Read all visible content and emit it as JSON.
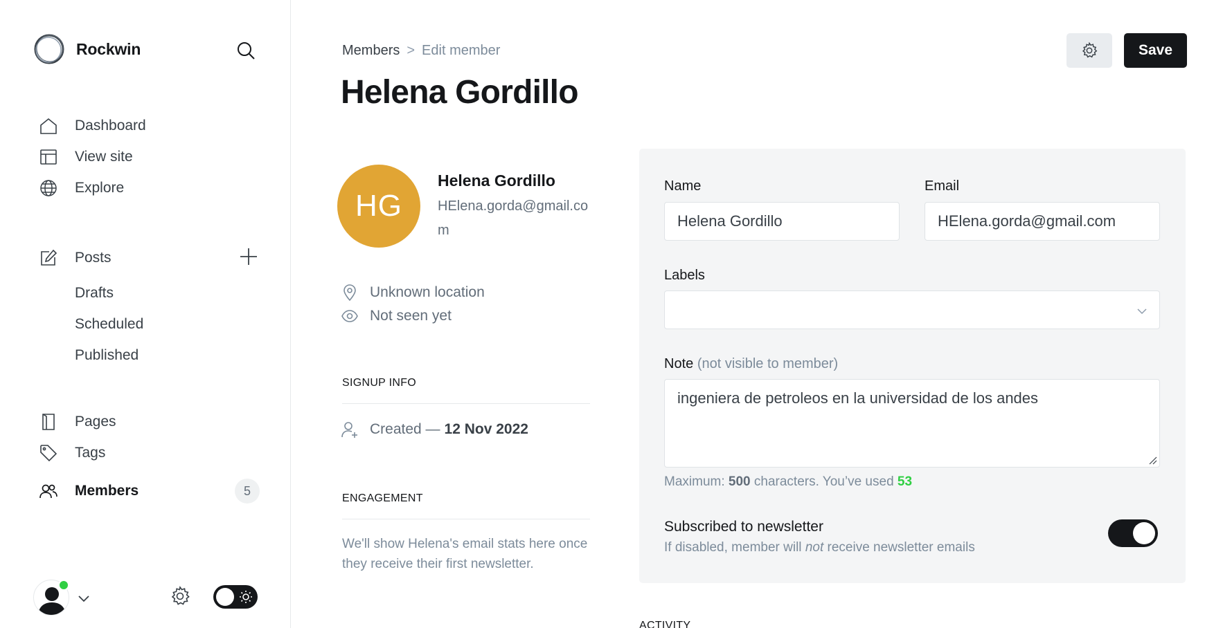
{
  "sidebar": {
    "brand": "Rockwin",
    "nav": {
      "dashboard": "Dashboard",
      "view_site": "View site",
      "explore": "Explore",
      "posts": "Posts",
      "drafts": "Drafts",
      "scheduled": "Scheduled",
      "published": "Published",
      "pages": "Pages",
      "tags": "Tags",
      "members": "Members",
      "members_count": "5"
    }
  },
  "header": {
    "breadcrumb_parent": "Members",
    "breadcrumb_separator": ">",
    "breadcrumb_current": "Edit member",
    "title": "Helena Gordillo",
    "save_label": "Save"
  },
  "member": {
    "initials": "HG",
    "name": "Helena Gordillo",
    "email": "HElena.gorda@gmail.com",
    "avatar_color": "#e1a534",
    "location": "Unknown location",
    "seen": "Not seen yet",
    "signup_heading": "SIGNUP INFO",
    "created_prefix": "Created —",
    "created_date": "12 Nov 2022",
    "engagement_heading": "ENGAGEMENT",
    "engagement_text": "We'll show Helena's email stats here once they receive their first newsletter."
  },
  "form": {
    "name_label": "Name",
    "name_value": "Helena Gordillo",
    "email_label": "Email",
    "email_value": "HElena.gorda@gmail.com",
    "labels_label": "Labels",
    "labels_value": "",
    "note_label": "Note",
    "note_hint": "(not visible to member)",
    "note_value": "ingeniera de petroleos en la universidad de los andes",
    "counter_prefix": "Maximum:",
    "counter_max": "500",
    "counter_mid": "characters. You’ve used",
    "counter_used": "53",
    "newsletter_title": "Subscribed to newsletter",
    "newsletter_hint_a": "If disabled, member will",
    "newsletter_hint_em": "not",
    "newsletter_hint_b": "receive newsletter emails",
    "newsletter_enabled": true
  },
  "activity_heading": "ACTIVITY",
  "colors": {
    "accent_dark": "#15171a",
    "online": "#30cf43",
    "counter_used": "#30cf43"
  },
  "icons": [
    "search-icon",
    "home-icon",
    "layout-icon",
    "globe-icon",
    "edit-icon",
    "plus-icon",
    "page-icon",
    "tag-icon",
    "members-icon",
    "gear-icon",
    "sun-icon",
    "location-icon",
    "eye-icon",
    "user-add-icon",
    "chevron-down-icon"
  ]
}
